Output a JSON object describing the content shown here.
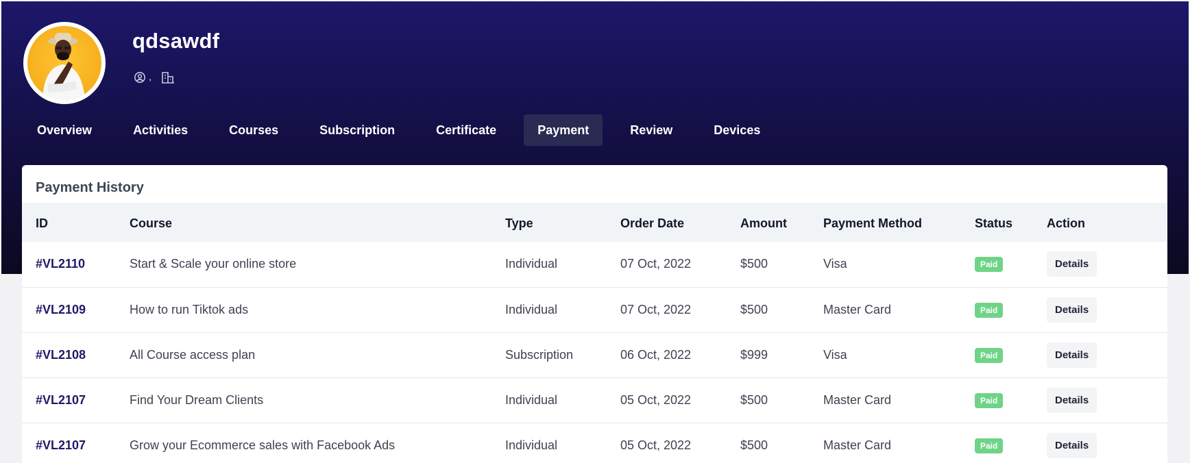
{
  "profile": {
    "username": "qdsawdf",
    "location_separator": ","
  },
  "tabs": [
    {
      "label": "Overview"
    },
    {
      "label": "Activities"
    },
    {
      "label": "Courses"
    },
    {
      "label": "Subscription"
    },
    {
      "label": "Certificate"
    },
    {
      "label": "Payment",
      "active": true
    },
    {
      "label": "Review"
    },
    {
      "label": "Devices"
    }
  ],
  "payment_history": {
    "title": "Payment History",
    "columns": [
      "ID",
      "Course",
      "Type",
      "Order Date",
      "Amount",
      "Payment Method",
      "Status",
      "Action"
    ],
    "rows": [
      {
        "id": "#VL2110",
        "course": "Start & Scale your online store",
        "type": "Individual",
        "date": "07 Oct, 2022",
        "amount": "$500",
        "method": "Visa",
        "status": "Paid",
        "action": "Details"
      },
      {
        "id": "#VL2109",
        "course": "How to run Tiktok ads",
        "type": "Individual",
        "date": "07 Oct, 2022",
        "amount": "$500",
        "method": "Master Card",
        "status": "Paid",
        "action": "Details"
      },
      {
        "id": "#VL2108",
        "course": "All Course access plan",
        "type": "Subscription",
        "date": "06 Oct, 2022",
        "amount": "$999",
        "method": "Visa",
        "status": "Paid",
        "action": "Details"
      },
      {
        "id": "#VL2107",
        "course": "Find Your Dream Clients",
        "type": "Individual",
        "date": "05 Oct, 2022",
        "amount": "$500",
        "method": "Master Card",
        "status": "Paid",
        "action": "Details"
      },
      {
        "id": "#VL2107",
        "course": "Grow your Ecommerce sales with Facebook Ads",
        "type": "Individual",
        "date": "05 Oct, 2022",
        "amount": "$500",
        "method": "Master Card",
        "status": "Paid",
        "action": "Details"
      }
    ]
  },
  "icons": {
    "location": "user-location-icon",
    "company": "building-icon"
  },
  "colors": {
    "header_dark": "#141048",
    "accent": "#1e1a66",
    "paid_badge": "#6fd487",
    "active_tab": "#2b2a52"
  }
}
